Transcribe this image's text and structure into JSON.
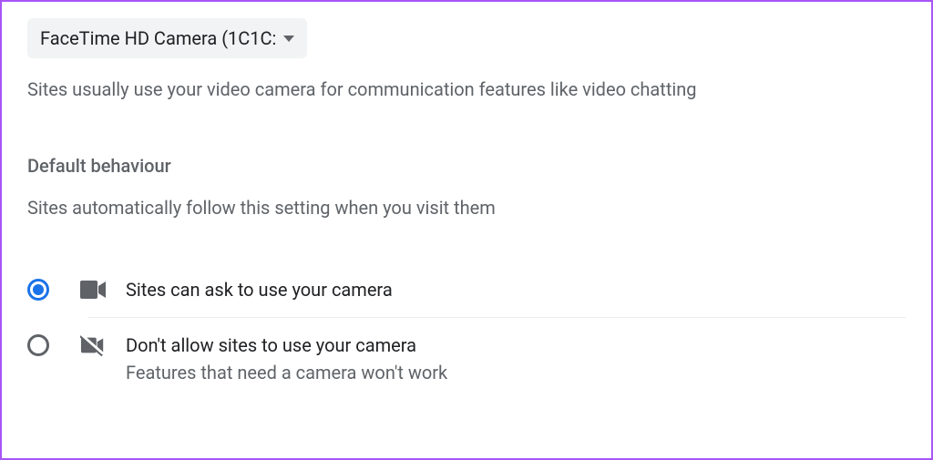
{
  "camera_select": {
    "label": "FaceTime HD Camera (1C1C:"
  },
  "description": "Sites usually use your video camera for communication features like video chatting",
  "section": {
    "heading": "Default behaviour",
    "subtext": "Sites automatically follow this setting when you visit them"
  },
  "options": {
    "allow": {
      "title": "Sites can ask to use your camera"
    },
    "block": {
      "title": "Don't allow sites to use your camera",
      "subtitle": "Features that need a camera won't work"
    }
  }
}
